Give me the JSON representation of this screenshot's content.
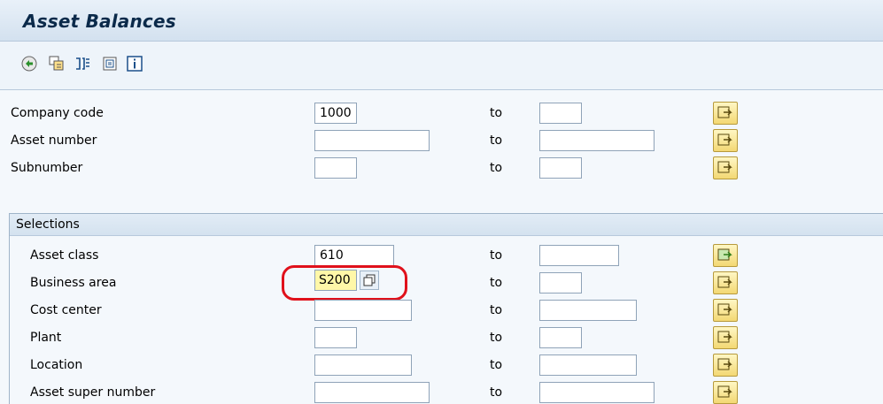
{
  "title": "Asset Balances",
  "toolbar": {
    "items": [
      {
        "icon": "execute-icon"
      },
      {
        "icon": "get-variant-icon"
      },
      {
        "icon": "dynamic-selections-icon"
      },
      {
        "icon": "data-sources-icon"
      },
      {
        "icon": "info-icon"
      }
    ]
  },
  "fields": [
    {
      "label": "Company code",
      "from": "1000",
      "to": ""
    },
    {
      "label": "Asset number",
      "from": "",
      "to": ""
    },
    {
      "label": "Subnumber",
      "from": "",
      "to": ""
    }
  ],
  "to_label": "to",
  "selections": {
    "title": "Selections",
    "fields": [
      {
        "label": "Asset class",
        "from": "610",
        "to": ""
      },
      {
        "label": "Business area",
        "from": "S200",
        "to": ""
      },
      {
        "label": "Cost center",
        "from": "",
        "to": ""
      },
      {
        "label": "Plant",
        "from": "",
        "to": ""
      },
      {
        "label": "Location",
        "from": "",
        "to": ""
      },
      {
        "label": "Asset super number",
        "from": "",
        "to": ""
      }
    ]
  },
  "colors": {
    "highlight": "#e0111b",
    "focus_field": "#fff7a8"
  }
}
